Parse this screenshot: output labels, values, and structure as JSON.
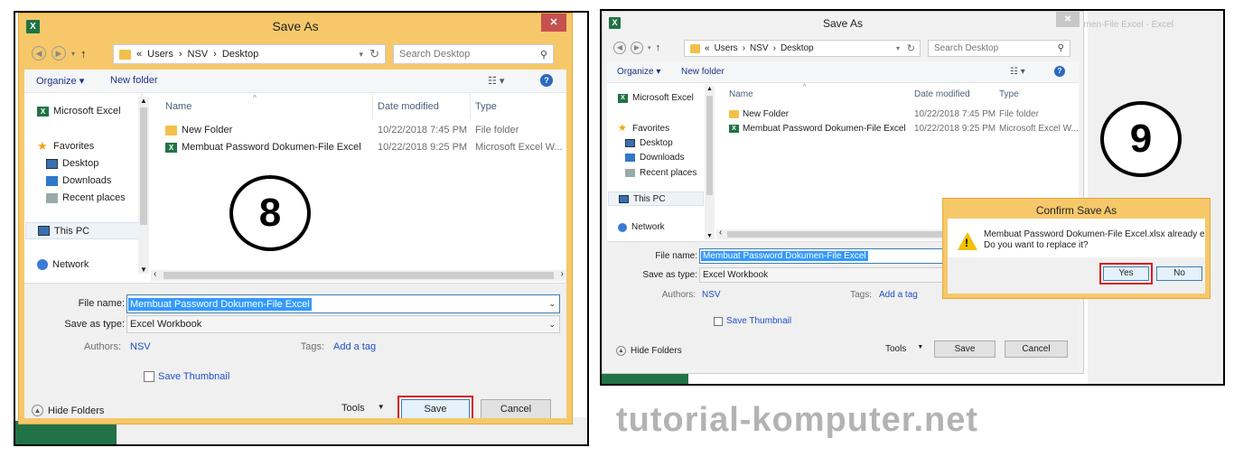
{
  "left": {
    "title": "Save As",
    "close_label": "✕",
    "nav": {
      "up": "↑",
      "path": [
        "«",
        "Users",
        "›",
        "NSV",
        "›",
        "Desktop"
      ],
      "refresh": "↻",
      "search_placeholder": "Search Desktop"
    },
    "toolbar": {
      "organize": "Organize ▾",
      "new_folder": "New folder",
      "view": "☷ ▾",
      "help": "?"
    },
    "sidebar": [
      {
        "label": "Microsoft Excel",
        "icon": "excel-icon"
      },
      {
        "label": "Favorites",
        "icon": "star-icon"
      },
      {
        "label": "Desktop",
        "icon": "desktop-icon"
      },
      {
        "label": "Downloads",
        "icon": "downloads-icon"
      },
      {
        "label": "Recent places",
        "icon": "recent-places-icon"
      },
      {
        "label": "This PC",
        "icon": "computer-icon"
      },
      {
        "label": "Network",
        "icon": "network-icon"
      }
    ],
    "columns": [
      "Name",
      "Date modified",
      "Type"
    ],
    "files": [
      {
        "name": "New Folder",
        "date": "10/22/2018 7:45 PM",
        "type": "File folder"
      },
      {
        "name": "Membuat Password Dokumen-File Excel",
        "date": "10/22/2018 9:25 PM",
        "type": "Microsoft Excel W..."
      }
    ],
    "form": {
      "file_name_label": "File name:",
      "file_name_value": "Membuat Password Dokumen-File Excel",
      "save_type_label": "Save as type:",
      "save_type_value": "Excel Workbook",
      "authors_label": "Authors:",
      "authors_value": "NSV",
      "tags_label": "Tags:",
      "tags_value": "Add a tag",
      "thumbnail": "Save Thumbnail",
      "hide_folders": "Hide Folders",
      "tools": "Tools",
      "save": "Save",
      "cancel": "Cancel"
    },
    "step": "8"
  },
  "right": {
    "title": "Save As",
    "close_label": "✕",
    "bg_text": "umen-File Excel - Excel",
    "nav": {
      "up": "↑",
      "path": [
        "«",
        "Users",
        "›",
        "NSV",
        "›",
        "Desktop"
      ],
      "refresh": "↻",
      "search_placeholder": "Search Desktop"
    },
    "toolbar": {
      "organize": "Organize ▾",
      "new_folder": "New folder",
      "view": "☷ ▾",
      "help": "?"
    },
    "sidebar": [
      {
        "label": "Microsoft Excel"
      },
      {
        "label": "Favorites"
      },
      {
        "label": "Desktop"
      },
      {
        "label": "Downloads"
      },
      {
        "label": "Recent places"
      },
      {
        "label": "This PC"
      },
      {
        "label": "Network"
      }
    ],
    "columns": [
      "Name",
      "Date modified",
      "Type"
    ],
    "files": [
      {
        "name": "New Folder",
        "date": "10/22/2018 7:45 PM",
        "type": "File folder"
      },
      {
        "name": "Membuat Password Dokumen-File Excel",
        "date": "10/22/2018 9:25 PM",
        "type": "Microsoft Excel W..."
      }
    ],
    "form": {
      "file_name_label": "File name:",
      "file_name_value": "Membuat Password Dokumen-File Excel",
      "save_type_label": "Save as type:",
      "save_type_value": "Excel Workbook",
      "authors_label": "Authors:",
      "authors_value": "NSV",
      "tags_label": "Tags:",
      "tags_value": "Add a tag",
      "thumbnail": "Save Thumbnail",
      "hide_folders": "Hide Folders",
      "tools": "Tools",
      "save": "Save",
      "cancel": "Cancel"
    },
    "confirm": {
      "title": "Confirm Save As",
      "message_line1": "Membuat Password Dokumen-File Excel.xlsx already exists.",
      "message_line2": "Do you want to replace it?",
      "yes": "Yes",
      "no": "No"
    },
    "step": "9"
  },
  "watermark": "tutorial-komputer.net"
}
